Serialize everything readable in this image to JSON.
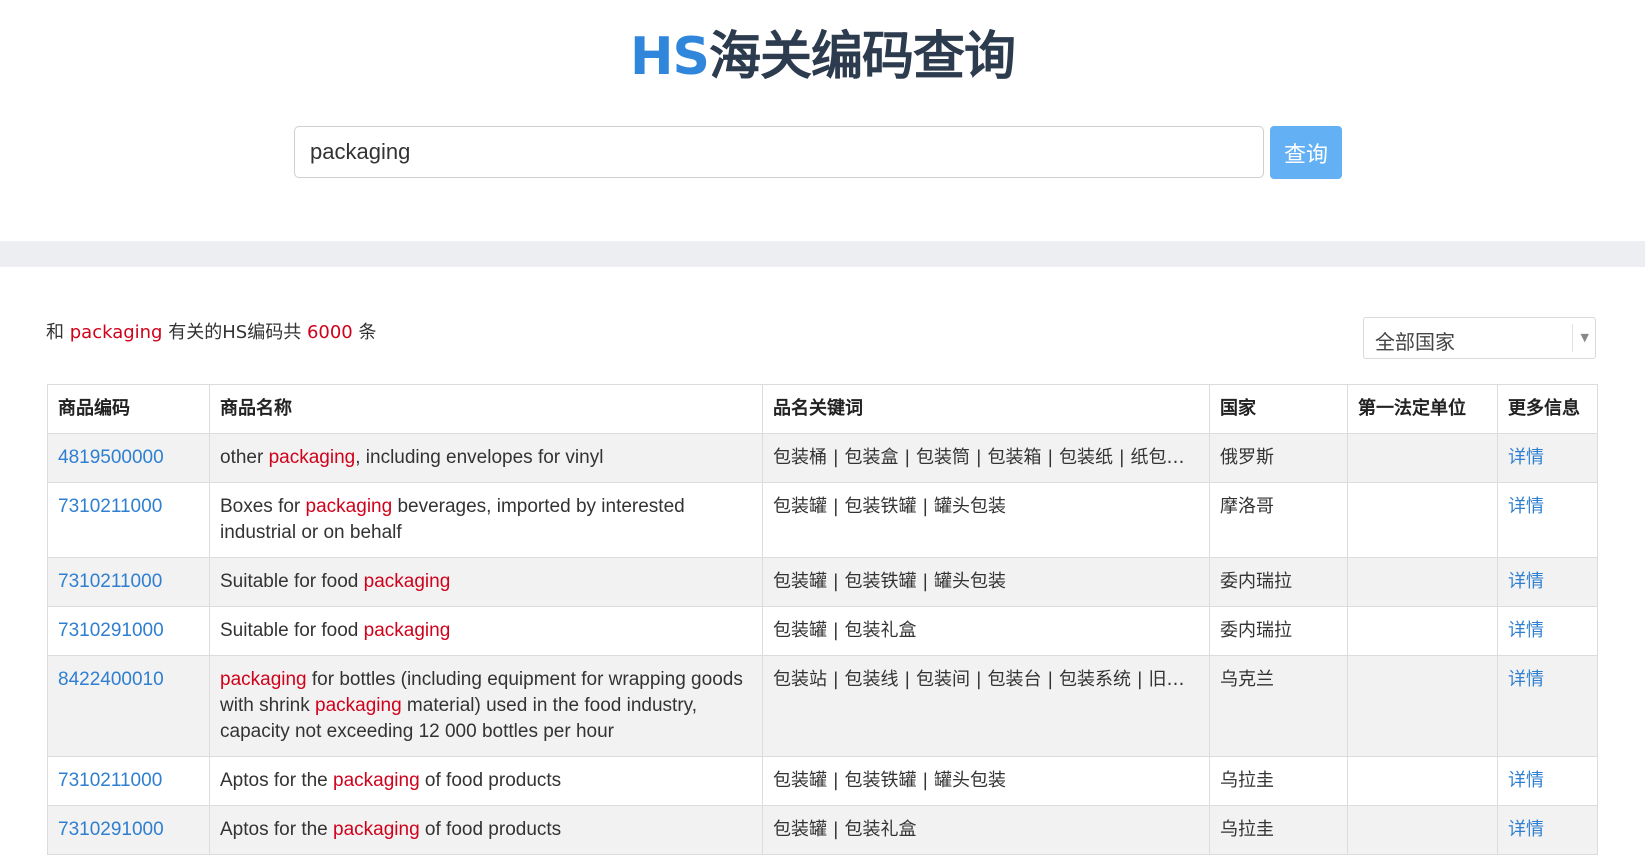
{
  "header": {
    "title_prefix": "HS",
    "title_rest": "海关编码查询"
  },
  "search": {
    "value": "packaging",
    "button_label": "查询"
  },
  "summary": {
    "pre": "和",
    "keyword": "packaging",
    "mid": "有关的HS编码共",
    "count": "6000",
    "post": "条"
  },
  "country_filter": {
    "selected": "全部国家"
  },
  "colors": {
    "accent": "#2f86db",
    "highlight": "#d0021b",
    "button": "#63b1f4",
    "link": "#2f7fd1"
  },
  "table": {
    "headers": [
      "商品编码",
      "商品名称",
      "品名关键词",
      "国家",
      "第一法定单位",
      "更多信息"
    ],
    "rows": [
      {
        "code": "4819500000",
        "name": [
          {
            "t": "other "
          },
          {
            "t": "packaging",
            "h": true
          },
          {
            "t": ", including envelopes for vinyl"
          }
        ],
        "keywords": "包装桶 | 包装盒 | 包装筒 | 包装箱 | 包装纸 | 纸包装 | 纸制包装 | 包装袋",
        "country": "俄罗斯",
        "unit": "",
        "detail": "详情"
      },
      {
        "code": "7310211000",
        "name": [
          {
            "t": "Boxes for "
          },
          {
            "t": "packaging",
            "h": true
          },
          {
            "t": " beverages, imported by interested industrial or on behalf"
          }
        ],
        "keywords": "包装罐 | 包装铁罐 | 罐头包装",
        "country": "摩洛哥",
        "unit": "",
        "detail": "详情"
      },
      {
        "code": "7310211000",
        "name": [
          {
            "t": "Suitable for food "
          },
          {
            "t": "packaging",
            "h": true
          }
        ],
        "keywords": "包装罐 | 包装铁罐 | 罐头包装",
        "country": "委内瑞拉",
        "unit": "",
        "detail": "详情"
      },
      {
        "code": "7310291000",
        "name": [
          {
            "t": "Suitable for food "
          },
          {
            "t": "packaging",
            "h": true
          }
        ],
        "keywords": "包装罐 | 包装礼盒",
        "country": "委内瑞拉",
        "unit": "",
        "detail": "详情"
      },
      {
        "code": "8422400010",
        "name": [
          {
            "t": "packaging",
            "h": true
          },
          {
            "t": " for bottles (including equipment for wrapping goods with shrink "
          },
          {
            "t": "packaging",
            "h": true
          },
          {
            "t": " material) used in the food industry, capacity not exceeding 12 000 bottles per hour"
          }
        ],
        "keywords": "包装站 | 包装线 | 包装间 | 包装台 | 包装系统 | 旧包装机械",
        "country": "乌克兰",
        "unit": "",
        "detail": "详情"
      },
      {
        "code": "7310211000",
        "name": [
          {
            "t": "Aptos for the "
          },
          {
            "t": "packaging",
            "h": true
          },
          {
            "t": " of food products"
          }
        ],
        "keywords": "包装罐 | 包装铁罐 | 罐头包装",
        "country": "乌拉圭",
        "unit": "",
        "detail": "详情"
      },
      {
        "code": "7310291000",
        "name": [
          {
            "t": "Aptos for the "
          },
          {
            "t": "packaging",
            "h": true
          },
          {
            "t": " of food products"
          }
        ],
        "keywords": "包装罐 | 包装礼盒",
        "country": "乌拉圭",
        "unit": "",
        "detail": "详情"
      }
    ]
  }
}
